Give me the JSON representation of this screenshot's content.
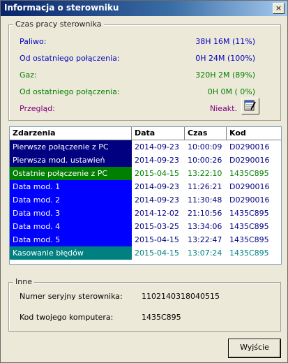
{
  "window": {
    "title": "Informacja o sterowniku",
    "close_label": "×"
  },
  "runtime": {
    "group_title": "Czas pracy sterownika",
    "rows": [
      {
        "label": "Paliwo:",
        "value": "38H 16M (11%)",
        "color": "#0000c0"
      },
      {
        "label": "Od ostatniego połączenia:",
        "value": "0H 24M (100%)",
        "color": "#0000c0"
      },
      {
        "label": "Gaz:",
        "value": "320H  2M (89%)",
        "color": "#008000"
      },
      {
        "label": "Od ostatniego połączenia:",
        "value": "0H  0M ( 0%)",
        "color": "#008000"
      },
      {
        "label": "Przegląd:",
        "value": "Nieakt.",
        "color": "#800080"
      }
    ]
  },
  "events": {
    "headers": [
      "Zdarzenia",
      "Data",
      "Czas",
      "Kod"
    ],
    "rows": [
      {
        "event": "Pierwsze połączenie z PC",
        "date": "2014-09-23",
        "time": "10:00:09",
        "code": "D0290016",
        "bg": "#000080",
        "fg": "#000080"
      },
      {
        "event": "Pierwsza mod. ustawień",
        "date": "2014-09-23",
        "time": "10:00:26",
        "code": "D0290016",
        "bg": "#000080",
        "fg": "#000080"
      },
      {
        "event": "Ostatnie połączenie z PC",
        "date": "2015-04-15",
        "time": "13:22:10",
        "code": "1435C895",
        "bg": "#008000",
        "fg": "#008000"
      },
      {
        "event": "Data mod. 1",
        "date": "2014-09-23",
        "time": "11:26:21",
        "code": "D0290016",
        "bg": "#0000ff",
        "fg": "#000080"
      },
      {
        "event": "Data mod. 2",
        "date": "2014-09-23",
        "time": "11:30:48",
        "code": "D0290016",
        "bg": "#0000ff",
        "fg": "#000080"
      },
      {
        "event": "Data mod. 3",
        "date": "2014-12-02",
        "time": "21:10:56",
        "code": "1435C895",
        "bg": "#0000ff",
        "fg": "#000080"
      },
      {
        "event": "Data mod. 4",
        "date": "2015-03-25",
        "time": "13:34:06",
        "code": "1435C895",
        "bg": "#0000ff",
        "fg": "#000080"
      },
      {
        "event": "Data mod. 5",
        "date": "2015-04-15",
        "time": "13:22:47",
        "code": "1435C895",
        "bg": "#0000ff",
        "fg": "#000080"
      },
      {
        "event": "Kasowanie błędów",
        "date": "2015-04-15",
        "time": "13:07:24",
        "code": "1435C895",
        "bg": "#008080",
        "fg": "#008080"
      }
    ]
  },
  "other": {
    "group_title": "Inne",
    "serial_label": "Numer seryjny sterownika:",
    "serial_value": "1102140318040515",
    "pc_code_label": "Kod twojego komputera:",
    "pc_code_value": "1435C895"
  },
  "buttons": {
    "exit_label": "Wyjście"
  },
  "icons": {
    "review": "calendar-edit-icon",
    "close": "close-icon"
  }
}
